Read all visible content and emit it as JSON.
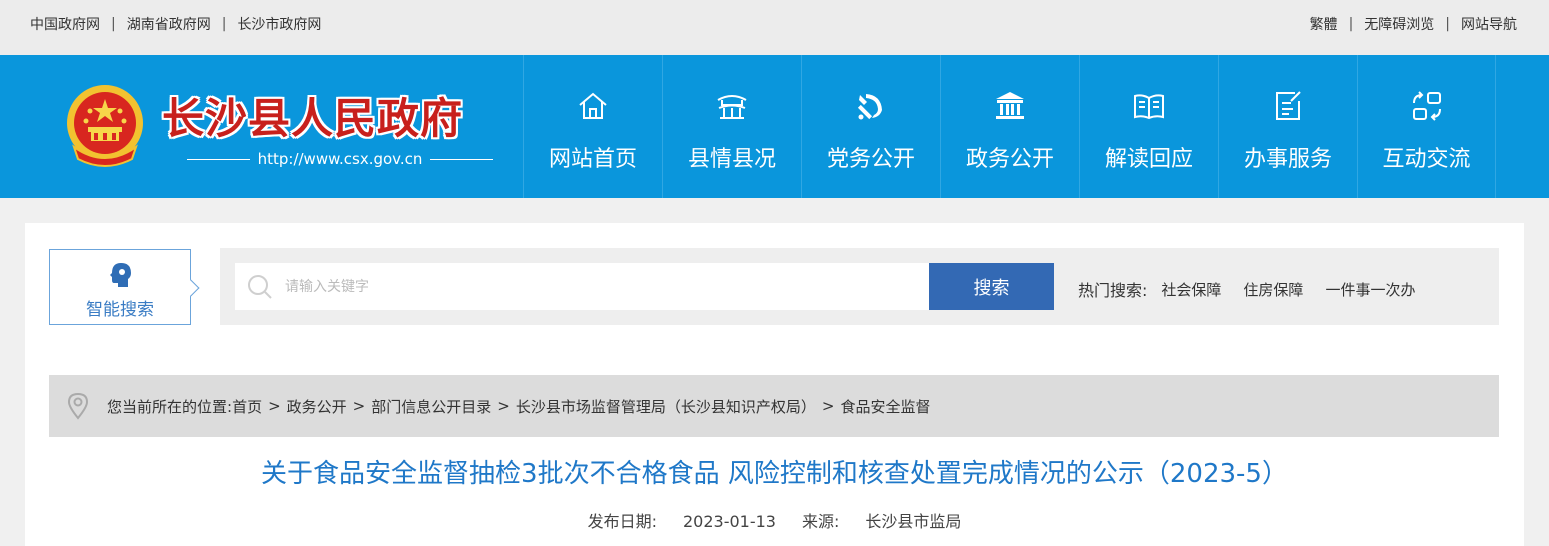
{
  "topbar": {
    "links_left": [
      "中国政府网",
      "湖南省政府网",
      "长沙市政府网"
    ],
    "links_right": [
      "繁體",
      "无障碍浏览",
      "网站导航"
    ]
  },
  "header": {
    "site_title": "长沙县人民政府",
    "site_url": "http://www.csx.gov.cn",
    "nav": [
      {
        "label": "网站首页",
        "icon": "home-icon"
      },
      {
        "label": "县情县况",
        "icon": "pavilion-icon"
      },
      {
        "label": "党务公开",
        "icon": "party-emblem-icon"
      },
      {
        "label": "政务公开",
        "icon": "government-building-icon"
      },
      {
        "label": "解读回应",
        "icon": "open-book-icon"
      },
      {
        "label": "办事服务",
        "icon": "document-edit-icon"
      },
      {
        "label": "互动交流",
        "icon": "interaction-icon"
      }
    ]
  },
  "search": {
    "smart_label": "智能搜索",
    "placeholder": "请输入关键字",
    "button_label": "搜索",
    "hot_title": "热门搜索:",
    "hot_items": [
      "社会保障",
      "住房保障",
      "一件事一次办"
    ]
  },
  "breadcrumb": {
    "prefix": "您当前所在的位置:",
    "items": [
      "首页",
      "政务公开",
      "部门信息公开目录",
      "长沙县市场监督管理局（长沙县知识产权局）",
      "食品安全监督"
    ]
  },
  "article": {
    "title": "关于食品安全监督抽检3批次不合格食品 风险控制和核查处置完成情况的公示（2023-5）",
    "date_label": "发布日期:",
    "date": "2023-01-13",
    "source_label": "来源:",
    "source": "长沙县市监局"
  },
  "colors": {
    "header_blue": "#0a96dc",
    "title_red": "#c8201c",
    "button_blue": "#3369b4",
    "article_title": "#1f78c8"
  }
}
